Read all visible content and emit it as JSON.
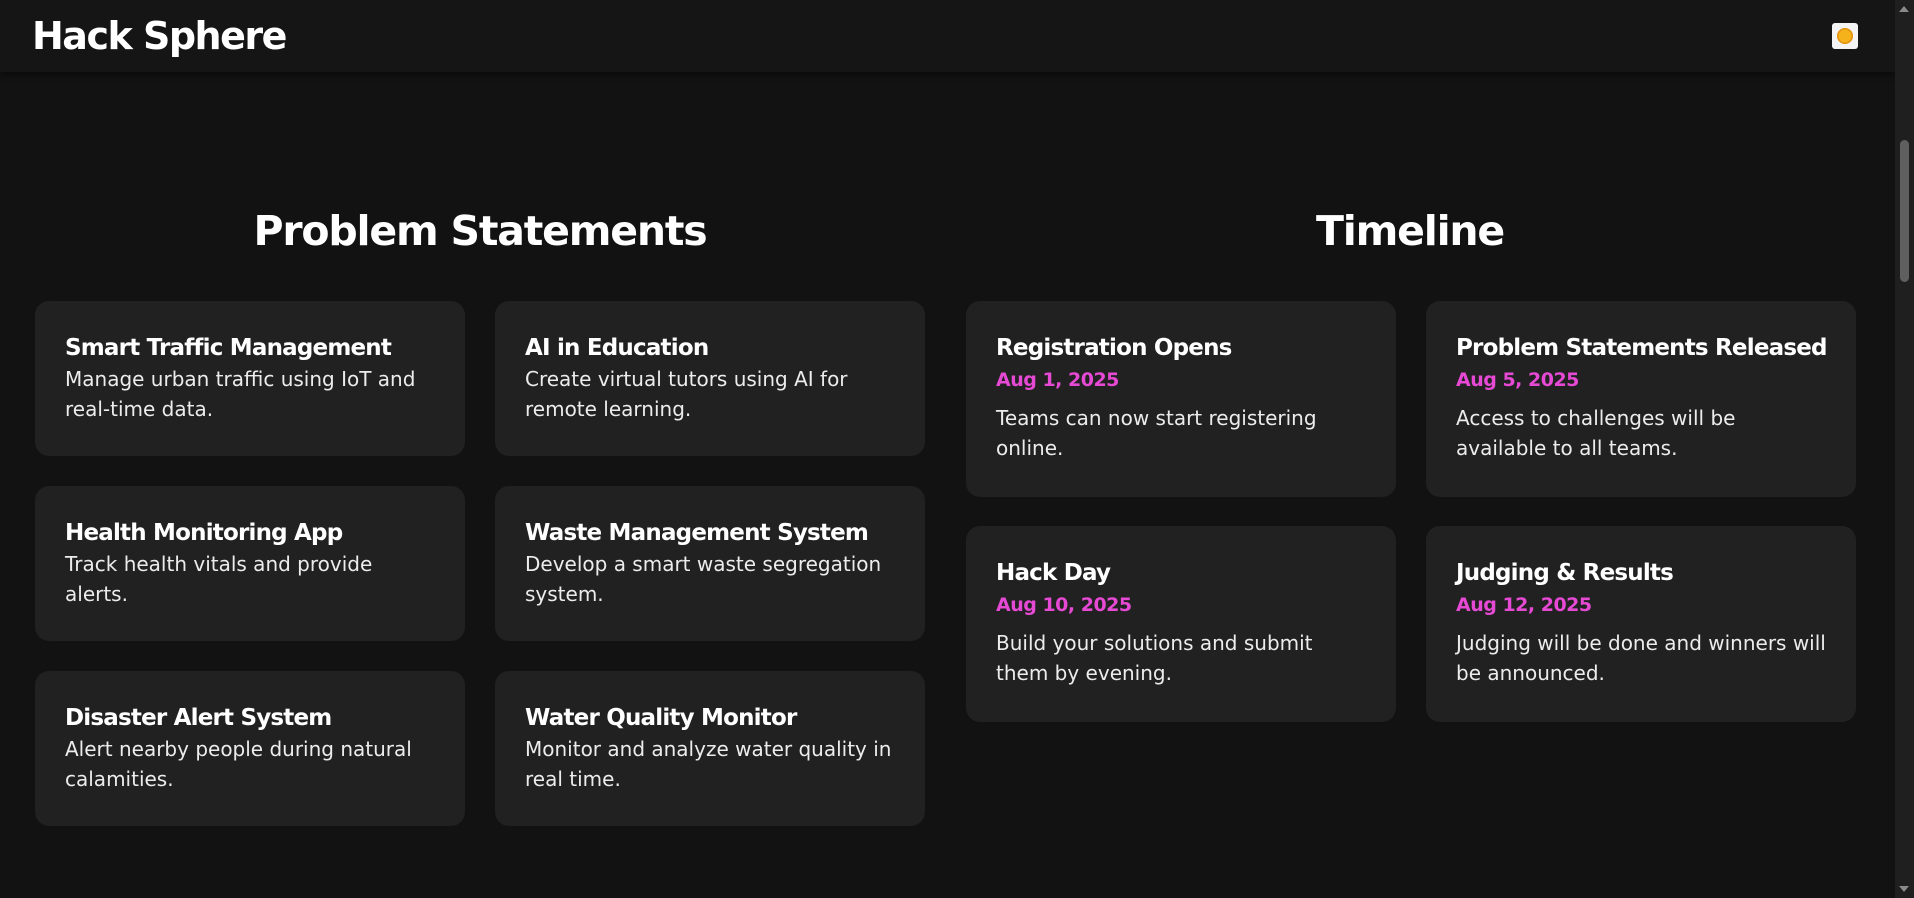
{
  "header": {
    "brand": "Hack Sphere",
    "theme_toggle_icon": "sun-icon"
  },
  "problem_statements": {
    "title": "Problem Statements",
    "items": [
      {
        "title": "Smart Traffic Management",
        "description": "Manage urban traffic using IoT and real-time data."
      },
      {
        "title": "AI in Education",
        "description": "Create virtual tutors using AI for remote learning."
      },
      {
        "title": "Health Monitoring App",
        "description": "Track health vitals and provide alerts."
      },
      {
        "title": "Waste Management System",
        "description": "Develop a smart waste segregation system."
      },
      {
        "title": "Disaster Alert System",
        "description": "Alert nearby people during natural calamities."
      },
      {
        "title": "Water Quality Monitor",
        "description": "Monitor and analyze water quality in real time."
      }
    ]
  },
  "timeline": {
    "title": "Timeline",
    "items": [
      {
        "title": "Registration Opens",
        "date": "Aug 1, 2025",
        "description": "Teams can now start registering online."
      },
      {
        "title": "Problem Statements Released",
        "date": "Aug 5, 2025",
        "description": "Access to challenges will be available to all teams."
      },
      {
        "title": "Hack Day",
        "date": "Aug 10, 2025",
        "description": "Build your solutions and submit them by evening."
      },
      {
        "title": "Judging & Results",
        "date": "Aug 12, 2025",
        "description": "Judging will be done and winners will be announced."
      }
    ]
  },
  "colors": {
    "background": "#121212",
    "card": "#212121",
    "accent_date": "#e649d4"
  }
}
